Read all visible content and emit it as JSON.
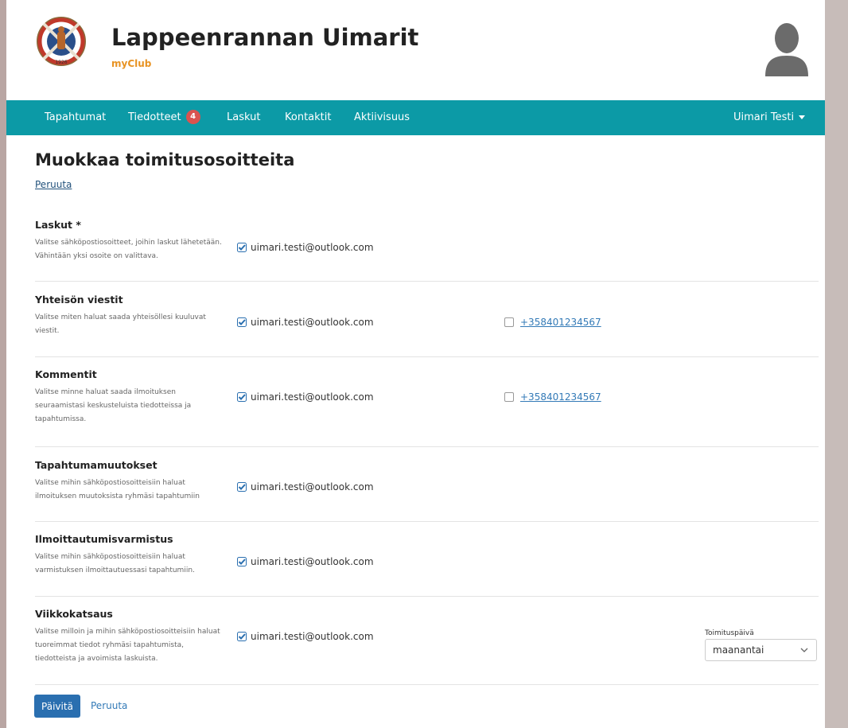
{
  "header": {
    "club_name": "Lappeenrannan Uimarit",
    "club_subtitle": "myClub",
    "logo_year": "1926"
  },
  "nav": {
    "items": [
      {
        "label": "Tapahtumat"
      },
      {
        "label": "Tiedotteet",
        "badge": "4"
      },
      {
        "label": "Laskut"
      },
      {
        "label": "Kontaktit"
      },
      {
        "label": "Aktiivisuus"
      }
    ],
    "user_menu": "Uimari Testi"
  },
  "page": {
    "title": "Muokkaa toimitusosoitteita",
    "cancel_link": "Peruuta"
  },
  "sections": [
    {
      "title": "Laskut *",
      "description": "Valitse sähköpostiosoitteet, joihin laskut lähetetään. Vähintään yksi osoite on valittava.",
      "email": "uimari.testi@outlook.com",
      "email_checked": true
    },
    {
      "title": "Yhteisön viestit",
      "description": "Valitse miten haluat saada yhteisöllesi kuuluvat viestit.",
      "email": "uimari.testi@outlook.com",
      "email_checked": true,
      "phone": "+358401234567",
      "phone_checked": false
    },
    {
      "title": "Kommentit",
      "description": "Valitse minne haluat saada ilmoituksen seuraamistasi keskusteluista tiedotteissa ja tapahtumissa.",
      "email": "uimari.testi@outlook.com",
      "email_checked": true,
      "phone": "+358401234567",
      "phone_checked": false
    },
    {
      "title": "Tapahtumamuutokset",
      "description": "Valitse mihin sähköpostiosoitteisiin haluat ilmoituksen muutoksista ryhmäsi tapahtumiin",
      "email": "uimari.testi@outlook.com",
      "email_checked": true
    },
    {
      "title": "Ilmoittautumisvarmistus",
      "description": "Valitse mihin sähköpostiosoitteisiin haluat varmistuksen ilmoittautuessasi tapahtumiin.",
      "email": "uimari.testi@outlook.com",
      "email_checked": true
    },
    {
      "title": "Viikkokatsaus",
      "description": "Valitse milloin ja mihin sähköpostiosoitteisiin haluat tuoreimmat tiedot ryhmäsi tapahtumista, tiedotteista ja avoimista laskuista.",
      "email": "uimari.testi@outlook.com",
      "email_checked": true
    }
  ],
  "delivery_day": {
    "label": "Toimituspäivä",
    "value": "maanantai"
  },
  "actions": {
    "update_label": "Päivitä",
    "cancel_label": "Peruuta"
  },
  "colors": {
    "nav_bg": "#0c9aa6",
    "brand_orange": "#e89323",
    "primary_button": "#2a6fb0",
    "badge": "#d9534f",
    "link": "#337ab7"
  }
}
